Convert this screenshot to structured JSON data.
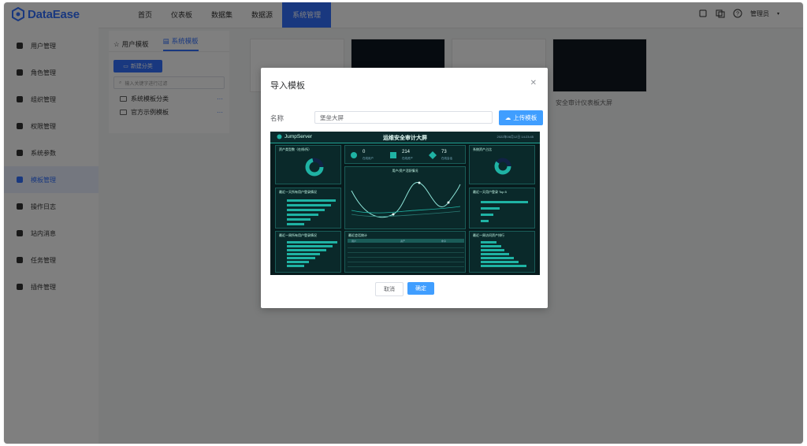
{
  "app": {
    "logo_text": "DataEase"
  },
  "topnav": {
    "menu": [
      "首页",
      "仪表板",
      "数据集",
      "数据源",
      "系统管理"
    ],
    "active_index": 4,
    "user": "管理员"
  },
  "sidebar": {
    "items": [
      {
        "label": "用户管理",
        "icon": "user-icon"
      },
      {
        "label": "角色管理",
        "icon": "role-icon"
      },
      {
        "label": "组织管理",
        "icon": "org-icon"
      },
      {
        "label": "权限管理",
        "icon": "lock-icon"
      },
      {
        "label": "系统参数",
        "icon": "settings-icon"
      },
      {
        "label": "模板管理",
        "icon": "template-icon",
        "active": true
      },
      {
        "label": "操作日志",
        "icon": "log-icon"
      },
      {
        "label": "站内消息",
        "icon": "bell-icon"
      },
      {
        "label": "任务管理",
        "icon": "task-icon"
      },
      {
        "label": "插件管理",
        "icon": "plugin-icon"
      }
    ]
  },
  "template_tree": {
    "tabs": [
      "用户模板",
      "系统模板"
    ],
    "active_tab": 1,
    "new_category": "新建分类",
    "search_placeholder": "输入关键字进行过滤",
    "nodes": [
      "系统模板分类",
      "官方示例模板"
    ]
  },
  "cards": {
    "last_label": "安全审计仪表板大屏"
  },
  "dialog": {
    "title": "导入模板",
    "name_label": "名称",
    "name_value": "堡垒大屏",
    "upload_label": "上传模板",
    "cancel_label": "取消",
    "ok_label": "确定"
  },
  "preview": {
    "brand": "JumpServer",
    "title": "运维安全审计大屏",
    "time": "2022年06月12日 14:23:45",
    "panel_titles": {
      "asset_type": "资产类型数（在线/所）",
      "user_sessions": "最近一天所有用户登录情况",
      "user_asset_trend": "用户/资产活跃情况",
      "top_assets": "最近一周所有用户登录情况",
      "asset_stats": "系统资产占比",
      "top_users": "最近一天用户登录 Top 5",
      "recent_logins": "最近会话统计",
      "weekly_top": "最近一周访问资产排行"
    },
    "stats": [
      {
        "value": "0",
        "label": "在线用户"
      },
      {
        "value": "214",
        "label": "在线资产"
      },
      {
        "value": "73",
        "label": "在线会话"
      }
    ],
    "table_headers": [
      "用户",
      "资产",
      "命令"
    ]
  },
  "colors": {
    "accent": "#3370ff",
    "primary_button": "#409eff",
    "preview_bg": "#071b1d",
    "preview_line": "#1fb3a4"
  }
}
